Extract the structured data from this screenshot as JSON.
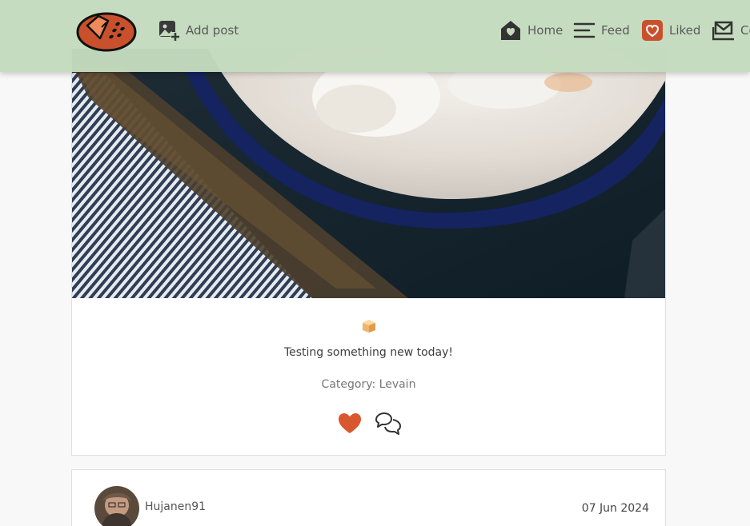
{
  "nav": {
    "add_post": "Add post",
    "home": "Home",
    "feed": "Feed",
    "liked": "Liked",
    "contact": "Co",
    "icons": [
      "logo-bread-icon",
      "add-image-icon",
      "home-heart-icon",
      "feed-lines-icon",
      "liked-heart-icon",
      "contact-mail-icon"
    ]
  },
  "post": {
    "emoji": "🍞",
    "title": "Testing something new today!",
    "category": "Category: Levain",
    "icons": [
      "heart-icon",
      "comments-icon"
    ],
    "colors": {
      "heart": "#d9572f"
    }
  },
  "next_post": {
    "author": "Hujanen91",
    "date": "07 Jun 2024"
  },
  "colors": {
    "navbar": "#c4dbbe",
    "accent": "#c9502c",
    "background": "#f8f8f8"
  }
}
